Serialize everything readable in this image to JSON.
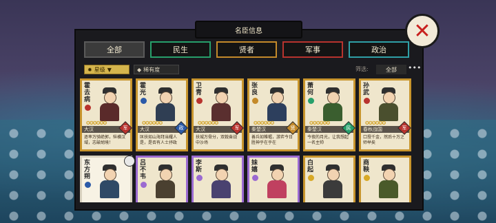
{
  "window_title": "名臣信息",
  "tabs": [
    {
      "label": "全部",
      "color": "#5a5a5a",
      "active": true
    },
    {
      "label": "民生",
      "color": "#27a06b",
      "active": false
    },
    {
      "label": "贤者",
      "color": "#c48a2a",
      "active": false
    },
    {
      "label": "军事",
      "color": "#b8332e",
      "active": false
    },
    {
      "label": "政治",
      "color": "#2fa0a6",
      "active": false
    }
  ],
  "filters": {
    "sort_label": "星级",
    "rarity_label": "稀有度",
    "filter_label": "筛选:",
    "filter_value": "全部"
  },
  "cards": [
    {
      "name": "霍去病",
      "era": "大汉",
      "badge": "军",
      "badge_color": "#b8332e",
      "border": "#c8952d",
      "desc": "逐率万骑绝郭，纵横汉域，志破胡境！"
    },
    {
      "name": "霍光",
      "era": "大汉",
      "badge": "政",
      "badge_color": "#2b5aa8",
      "border": "#c8952d",
      "desc": "匡扶如山海拜当耀人是，是否有人士抒政"
    },
    {
      "name": "卫青",
      "era": "大汉",
      "badge": "军",
      "badge_color": "#b8332e",
      "border": "#c8952d",
      "desc": "扶城万骨分，双戟奋战中沙场"
    },
    {
      "name": "张良",
      "era": "秦楚汉",
      "badge": "贤",
      "badge_color": "#c48a2a",
      "border": "#c8952d",
      "desc": "善兵如帷幄，游弈今日胜神乎在乎在"
    },
    {
      "name": "萧何",
      "era": "秦楚汉",
      "badge": "民",
      "badge_color": "#27a06b",
      "border": "#c8952d",
      "desc": "今夜的月光，让我想起一名主帅"
    },
    {
      "name": "孙武",
      "era": "春秋战国",
      "badge": "军",
      "badge_color": "#b8332e",
      "border": "#c8952d",
      "desc": "口授千金，然后十万之师举矣"
    },
    {
      "name": "东方朔",
      "era": "",
      "badge": "",
      "badge_color": "#2b5aa8",
      "border": "#d9d2c0",
      "desc": ""
    },
    {
      "name": "吕不韦",
      "era": "",
      "badge": "",
      "badge_color": "#9b6ad1",
      "border": "#9b6ad1",
      "desc": ""
    },
    {
      "name": "李斯",
      "era": "",
      "badge": "",
      "badge_color": "#9b6ad1",
      "border": "#9b6ad1",
      "desc": ""
    },
    {
      "name": "妹嬉",
      "era": "",
      "badge": "",
      "badge_color": "#9b6ad1",
      "border": "#9b6ad1",
      "desc": ""
    },
    {
      "name": "白起",
      "era": "",
      "badge": "",
      "badge_color": "#d8a926",
      "border": "#c8952d",
      "desc": ""
    },
    {
      "name": "商鞅",
      "era": "",
      "badge": "",
      "badge_color": "#d8a926",
      "border": "#c8952d",
      "desc": ""
    }
  ]
}
